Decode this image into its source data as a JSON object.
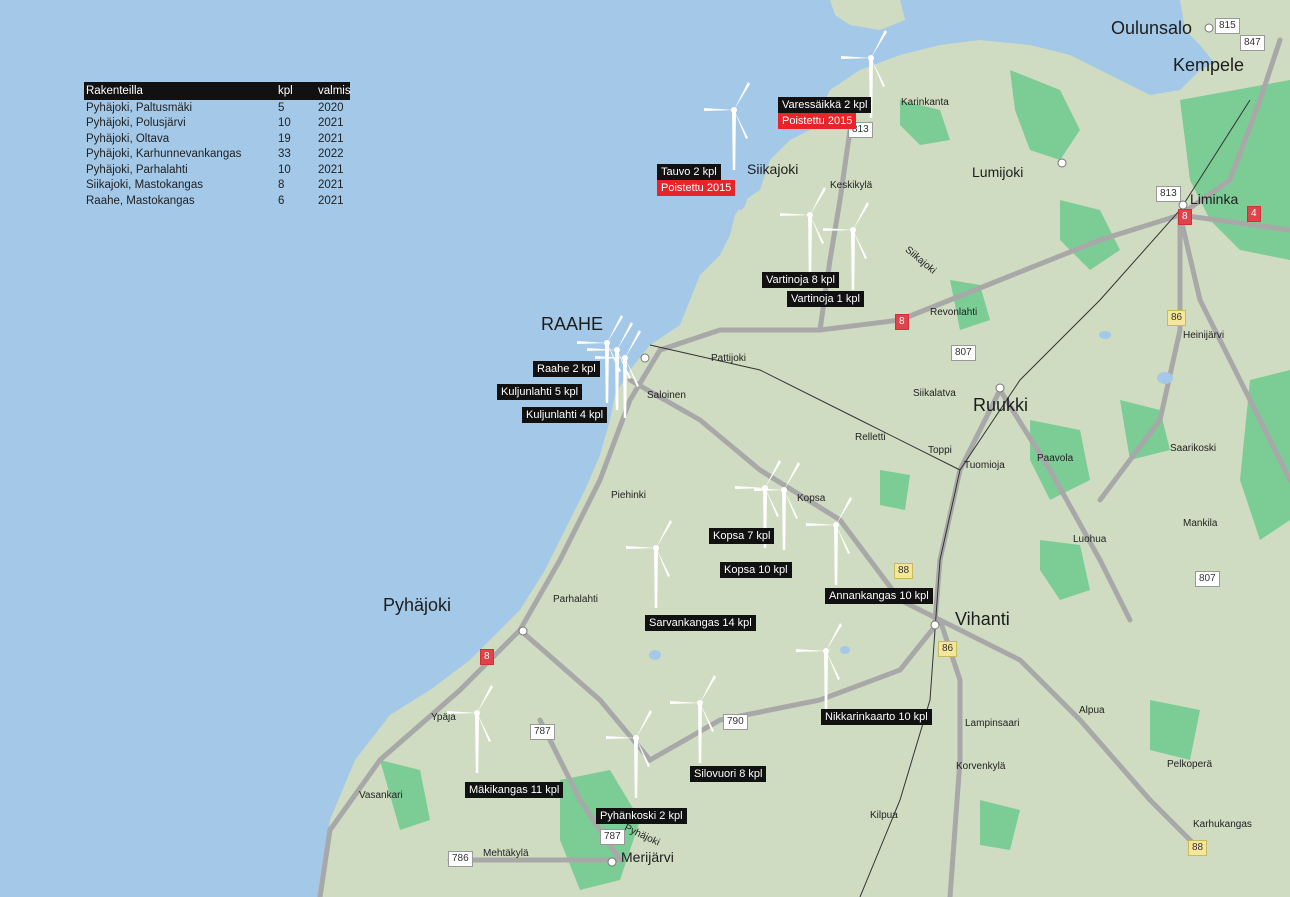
{
  "legend": {
    "headers": {
      "name": "Rakenteilla",
      "count": "kpl",
      "ready": "valmis"
    },
    "rows": [
      {
        "name": "Pyhäjoki, Paltusmäki",
        "count": "5",
        "ready": "2020"
      },
      {
        "name": "Pyhäjoki, Polusjärvi",
        "count": "10",
        "ready": "2021"
      },
      {
        "name": "Pyhäjoki, Oltava",
        "count": "19",
        "ready": "2021"
      },
      {
        "name": "Pyhäjoki, Karhunnevankangas",
        "count": "33",
        "ready": "2022"
      },
      {
        "name": "Pyhäjoki, Parhalahti",
        "count": "10",
        "ready": "2021"
      },
      {
        "name": "Siikajoki, Mastokangas",
        "count": "8",
        "ready": "2021"
      },
      {
        "name": "Raahe, Mastokangas",
        "count": "6",
        "ready": "2021"
      }
    ]
  },
  "towns_large": [
    "Oulunsalo",
    "Kempele",
    "RAAHE",
    "Ruukki",
    "Pyhäjoki",
    "Vihanti"
  ],
  "towns_medium": [
    "Siikajoki",
    "Lumijoki",
    "Liminka",
    "Merijärvi"
  ],
  "villages": [
    "Karinkanta",
    "Keskikylä",
    "Siikajoki",
    "Revonlahti",
    "Heinijärvi",
    "Pattijoki",
    "Saloinen",
    "Siikalatva",
    "Relletti",
    "Toppi",
    "Tuomioja",
    "Paavola",
    "Saarikoski",
    "Kopsa",
    "Piehinki",
    "Mankila",
    "Luohua",
    "Parhalahti",
    "Ypäjä",
    "Lampinsaari",
    "Alpua",
    "Korvenkylä",
    "Pelkoperä",
    "Vasankari",
    "Kilpua",
    "Karhukangas",
    "Mehtäkylä",
    "Pyhäjoki"
  ],
  "roads": [
    "815",
    "847",
    "813",
    "813",
    "8",
    "4",
    "86",
    "807",
    "8",
    "88",
    "86",
    "807",
    "8",
    "787",
    "790",
    "787",
    "786",
    "88"
  ],
  "farms": [
    {
      "label": "Varessäikkä 2 kpl",
      "removed": "Poistettu 2015"
    },
    {
      "label": "Tauvo 2 kpl",
      "removed": "Poistettu 2015"
    },
    {
      "label": "Vartinoja 8 kpl"
    },
    {
      "label": "Vartinoja 1 kpl"
    },
    {
      "label": "Raahe 2 kpl"
    },
    {
      "label": "Kuljunlahti 5 kpl"
    },
    {
      "label": "Kuljunlahti 4 kpl"
    },
    {
      "label": "Kopsa 7 kpl"
    },
    {
      "label": "Kopsa 10 kpl"
    },
    {
      "label": "Annankangas 10 kpl"
    },
    {
      "label": "Sarvankangas 14 kpl"
    },
    {
      "label": "Nikkarinkaarto 10 kpl"
    },
    {
      "label": "Silovuori 8 kpl"
    },
    {
      "label": "Mäkikangas 11 kpl"
    },
    {
      "label": "Pyhänkoski 2 kpl"
    }
  ],
  "colors": {
    "sea": "#a4c8e8",
    "land": "#cfdcc1",
    "forest": "#7ccc96",
    "road": "#a8a8a8",
    "turbine": "#ffffff",
    "label_bg": "#111111",
    "removed_bg": "#e8242a"
  },
  "icons": [
    "wind-turbine-icon",
    "town-dot-icon"
  ]
}
